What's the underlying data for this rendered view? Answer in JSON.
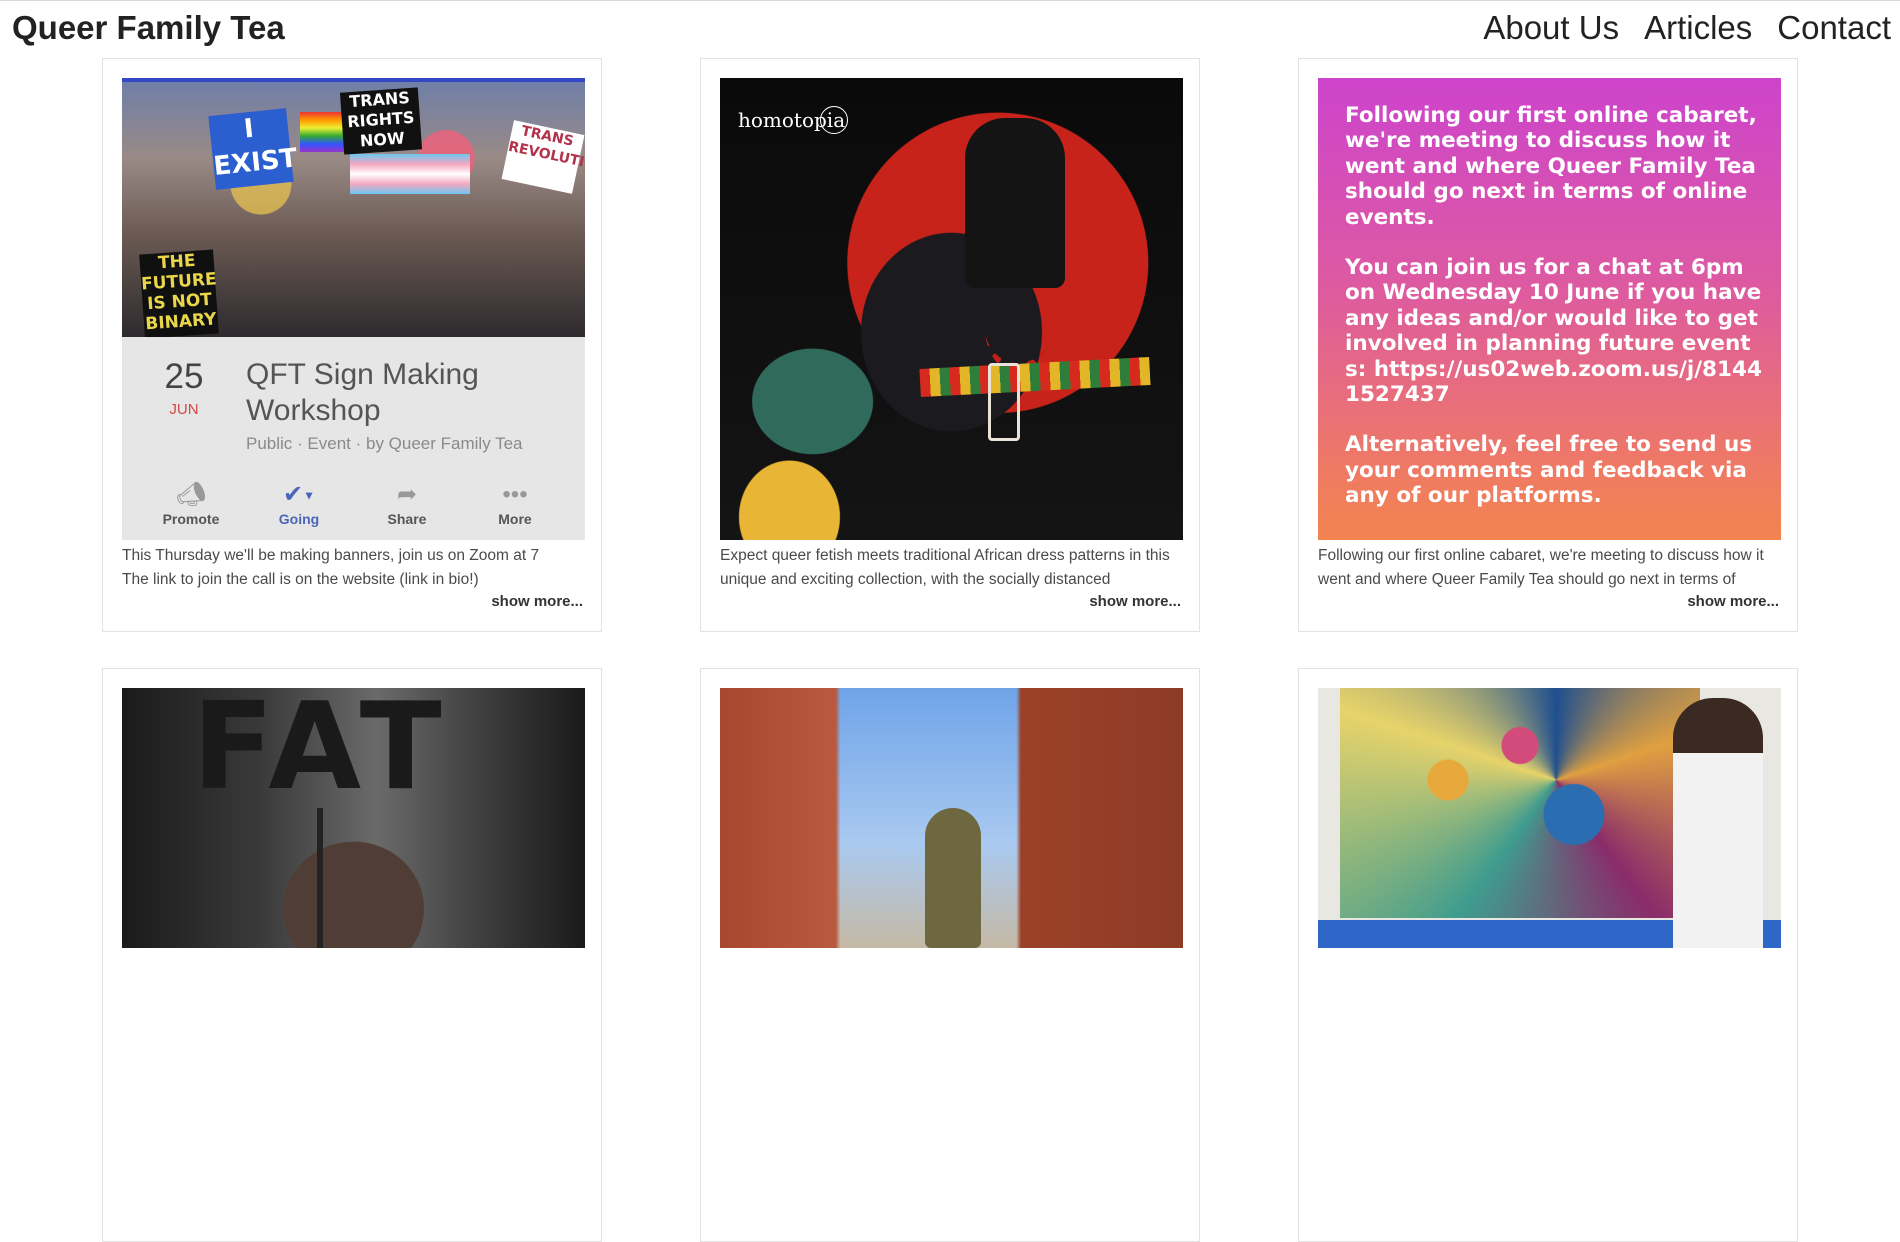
{
  "site": {
    "brand": "Queer Family Tea",
    "nav": [
      "About Us",
      "Articles",
      "Contact"
    ]
  },
  "cards": [
    {
      "image": "event-screenshot",
      "event": {
        "day": "25",
        "month": "JUN",
        "title": "QFT Sign Making Workshop",
        "meta": "Public · Event · by Queer Family Tea",
        "actions": [
          "Promote",
          "Going",
          "Share",
          "More"
        ],
        "signs": [
          "I EXIST",
          "TRANS RIGHTS NOW",
          "TRANS REVOLUTION",
          "THE FUTURE IS NOT BINARY"
        ]
      },
      "excerpt": [
        "This Thursday we'll be making banners, join us on Zoom at 7",
        "The link to join the call is on the website (link in bio!)"
      ],
      "more": "show more..."
    },
    {
      "image": "homotopia-dress",
      "logo": "homotopia",
      "excerpt": [
        "Expect queer fetish meets traditional African dress patterns in this",
        "unique and exciting collection, with the socially distanced"
      ],
      "more": "show more..."
    },
    {
      "image": "announcement-graphic",
      "graphic_text": [
        "Following our first online cabaret, we're meeting to discuss how it went and where Queer Family Tea should go next in terms of online events.",
        "You can join us for a chat at 6pm on Wednesday 10 June if you have any ideas and/or would like to get involved in planning future events: https://us02web.zoom.us/j/81441527437",
        "Alternatively, feel free to send us your comments and feedback via any of our platforms."
      ],
      "excerpt": [
        "Following our first online cabaret, we're meeting to discuss how it",
        "went and where Queer Family Tea should go next in terms of"
      ],
      "more": "show more..."
    },
    {
      "image": "performer-fat-stage",
      "stage_text": "FAT"
    },
    {
      "image": "person-between-buildings"
    },
    {
      "image": "artist-with-painting"
    }
  ],
  "colors": {
    "event_info_bg": "#e6e6e6",
    "going_blue": "#4b66b8",
    "month_red": "#d2484a",
    "graphic_gradient": [
      "#cd44cc",
      "#f38450"
    ]
  }
}
